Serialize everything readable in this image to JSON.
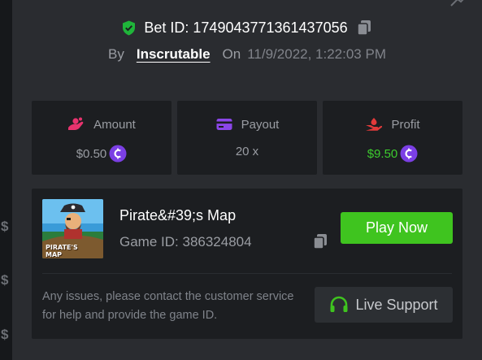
{
  "side": {
    "currency_symbol": "$"
  },
  "bet": {
    "label": "Bet ID:",
    "id": "1749043771361437056",
    "by_label": "By",
    "user": "Inscrutable",
    "on_label": "On",
    "datetime": "11/9/2022, 1:22:03 PM"
  },
  "stats": {
    "amount": {
      "label": "Amount",
      "value": "$0.50",
      "icon": "amount-icon"
    },
    "payout": {
      "label": "Payout",
      "value": "20 x",
      "icon": "payout-card-icon"
    },
    "profit": {
      "label": "Profit",
      "value": "$9.50",
      "icon": "profit-hand-icon"
    }
  },
  "game": {
    "name": "Pirate&#39;s Map",
    "id_label": "Game ID:",
    "id": "386324804",
    "thumb_title": "PIRATE'S MAP",
    "play_label": "Play Now"
  },
  "support": {
    "help_text": "Any issues, please contact the customer service for help and provide the game ID.",
    "button_label": "Live Support"
  },
  "colors": {
    "background": "#2a2c30",
    "card": "#1c1e21",
    "accent_green": "#3fc41f",
    "profit_green": "#3dcc2e",
    "coin_purple": "#7b3fe4",
    "amount_pink": "#e8336e",
    "payout_purple": "#8b46e8",
    "profit_red": "#e23a3a",
    "shield_green": "#1fb53a"
  }
}
